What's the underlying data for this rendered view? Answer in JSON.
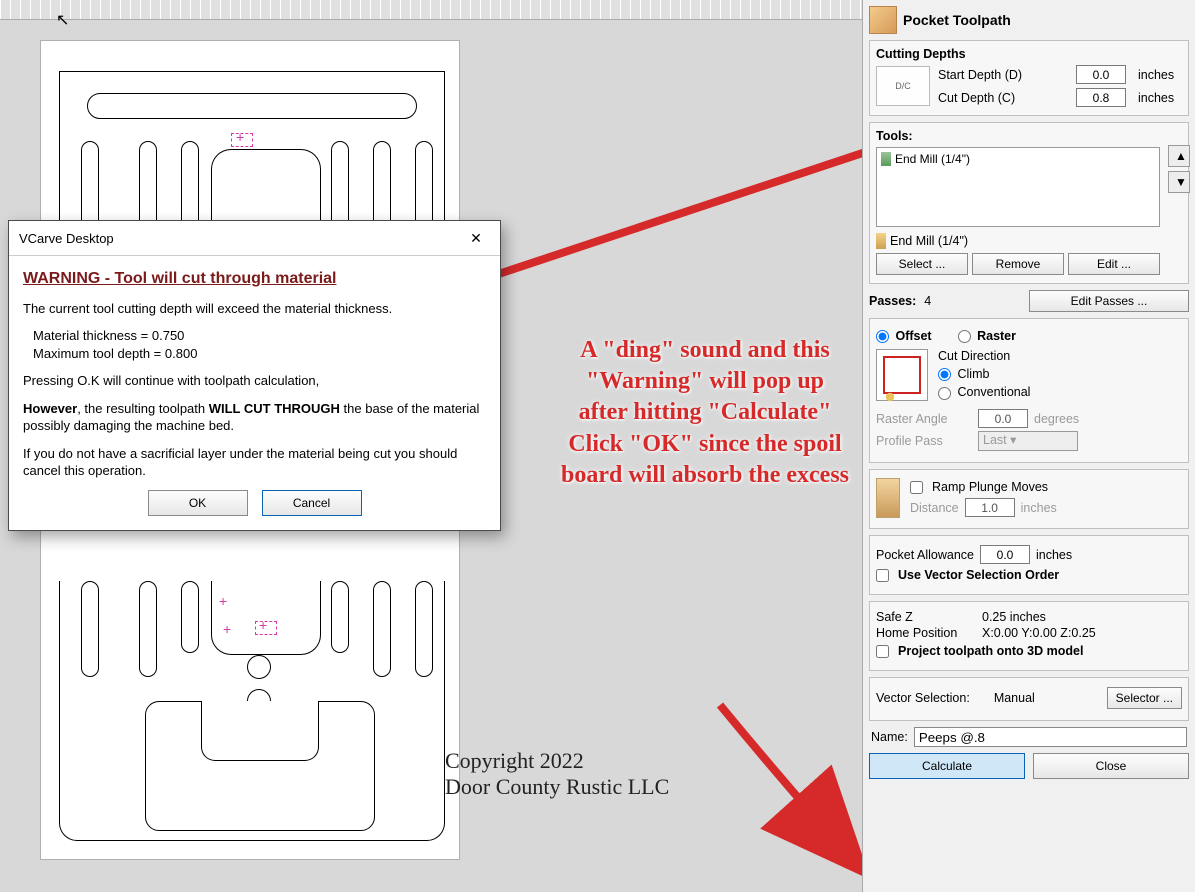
{
  "panel": {
    "title": "Pocket Toolpath",
    "depths": {
      "section": "Cutting Depths",
      "start_label": "Start Depth (D)",
      "start_value": "0.0",
      "cut_label": "Cut Depth (C)",
      "cut_value": "0.8",
      "unit": "inches"
    },
    "tools": {
      "section": "Tools:",
      "listed_tool": "End Mill (1/4\")",
      "selected_tool": "End Mill (1/4\")",
      "select_btn": "Select ...",
      "remove_btn": "Remove",
      "edit_btn": "Edit ..."
    },
    "passes": {
      "label": "Passes:",
      "value": "4",
      "edit_btn": "Edit Passes ..."
    },
    "style": {
      "offset": "Offset",
      "raster": "Raster",
      "cutdir_label": "Cut Direction",
      "climb": "Climb",
      "conventional": "Conventional",
      "raster_angle_label": "Raster Angle",
      "raster_angle_value": "0.0",
      "raster_angle_unit": "degrees",
      "profile_pass_label": "Profile Pass",
      "profile_pass_value": "Last"
    },
    "ramp": {
      "label": "Ramp Plunge Moves",
      "distance_label": "Distance",
      "distance_value": "1.0",
      "distance_unit": "inches"
    },
    "allowance": {
      "label": "Pocket Allowance",
      "value": "0.0",
      "unit": "inches",
      "use_vso": "Use Vector Selection Order"
    },
    "info": {
      "safez_label": "Safe Z",
      "safez_value": "0.25 inches",
      "home_label": "Home Position",
      "home_value": "X:0.00 Y:0.00 Z:0.25",
      "project_3d": "Project toolpath onto 3D model"
    },
    "vsel": {
      "label": "Vector Selection:",
      "mode": "Manual",
      "btn": "Selector ..."
    },
    "name": {
      "label": "Name:",
      "value": "Peeps @.8"
    },
    "footer": {
      "calculate": "Calculate",
      "close": "Close"
    }
  },
  "dialog": {
    "app": "VCarve Desktop",
    "heading": "WARNING - Tool will cut through material",
    "line1": "The current tool cutting depth will exceed the material thickness.",
    "mthick_label": "Material thickness =",
    "mthick_value": "0.750",
    "mdepth_label": "Maximum tool depth =",
    "mdepth_value": "0.800",
    "line2": "Pressing O.K will continue with toolpath calculation,",
    "line3a": "However",
    "line3b": ", the resulting toolpath ",
    "line3c": "WILL CUT THROUGH",
    "line3d": " the base of the material possibly damaging the machine bed.",
    "line4": "If you do not have a sacrificial layer under the material being cut you should cancel this operation.",
    "ok": "OK",
    "cancel": "Cancel"
  },
  "annotation": {
    "text": "A \"ding\" sound and this \"Warning\" will pop up after hitting \"Calculate\" Click \"OK\" since the spoil board will absorb the excess"
  },
  "copyright": {
    "line1": "Copyright 2022",
    "line2": "Door County Rustic LLC"
  }
}
